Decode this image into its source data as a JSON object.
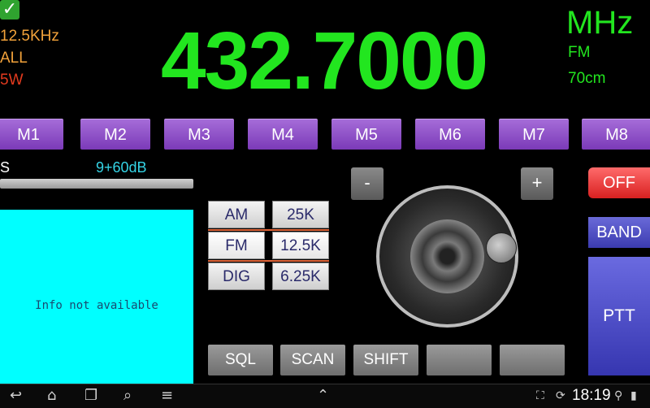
{
  "status": {
    "check_icon": "checkmark-icon",
    "step": "12.5KHz",
    "squelch_mode": "ALL",
    "power": "5W"
  },
  "frequency": {
    "value": "432.7000",
    "unit": "MHz",
    "modulation": "FM",
    "band": "70cm"
  },
  "memory_buttons": [
    "M1",
    "M2",
    "M3",
    "M4",
    "M5",
    "M6",
    "M7",
    "M8"
  ],
  "s_meter": {
    "label": "S",
    "reading": "9+60dB"
  },
  "info_panel": {
    "text": "Info not available"
  },
  "mode_grid": [
    {
      "mode": "AM",
      "step": "25K"
    },
    {
      "mode": "FM",
      "step": "12.5K"
    },
    {
      "mode": "DIG",
      "step": "6.25K"
    }
  ],
  "tuning": {
    "minus_label": "-",
    "plus_label": "+"
  },
  "right_panel": {
    "off_label": "OFF",
    "band_label": "BAND",
    "ptt_label": "PTT"
  },
  "function_buttons": [
    "SQL",
    "SCAN",
    "SHIFT",
    "",
    ""
  ],
  "system_bar": {
    "time": "18:19",
    "icons": [
      "back-icon",
      "home-icon",
      "recent-apps-icon",
      "search-icon",
      "menu-icon",
      "chevron-up-icon",
      "screen-expand-icon",
      "sync-icon",
      "usb-icon",
      "battery-icon"
    ]
  },
  "colors": {
    "frequency": "#22e61f",
    "step": "#f2a23a",
    "power": "#e23a1e",
    "memory": "#8e4ec8",
    "info_panel": "#00ffff",
    "off": "#e02828",
    "ptt": "#4545c0"
  }
}
